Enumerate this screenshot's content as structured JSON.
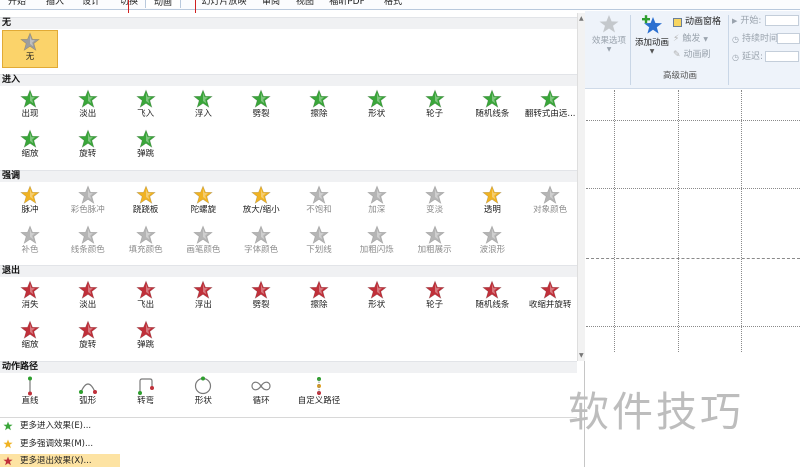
{
  "ribbon_tabs": [
    "开始",
    "插入",
    "设计",
    "切换",
    "动画",
    "幻灯片放映",
    "审阅",
    "视图",
    "福昕PDF",
    "格式"
  ],
  "active_tab": "动画",
  "ribbon": {
    "effect_options": "效果选项",
    "add_animation": "添加动画",
    "animation_pane": "动画窗格",
    "trigger": "触发",
    "animation_painter": "动画刷",
    "advanced_group": "高级动画",
    "start_label": "开始:",
    "duration_label": "持续时间:",
    "delay_label": "延迟:"
  },
  "sections": {
    "none": "无",
    "entrance": "进入",
    "emphasis": "强调",
    "exit": "退出",
    "motion": "动作路径"
  },
  "none_item": "无",
  "entrance_items": [
    "出现",
    "淡出",
    "飞入",
    "浮入",
    "劈裂",
    "擦除",
    "形状",
    "轮子",
    "随机线条",
    "翻转式由远...",
    "缩放",
    "旋转",
    "弹跳"
  ],
  "emphasis_items": [
    "脉冲",
    "彩色脉冲",
    "跷跷板",
    "陀螺旋",
    "放大/缩小",
    "不饱和",
    "加深",
    "变淡",
    "透明",
    "对象颜色",
    "补色",
    "线条颜色",
    "填充颜色",
    "画笔颜色",
    "字体颜色",
    "下划线",
    "加粗闪烁",
    "加粗展示",
    "波浪形"
  ],
  "exit_items": [
    "消失",
    "淡出",
    "飞出",
    "浮出",
    "劈裂",
    "擦除",
    "形状",
    "轮子",
    "随机线条",
    "收缩并旋转",
    "缩放",
    "旋转",
    "弹跳"
  ],
  "motion_items": [
    "直线",
    "弧形",
    "转弯",
    "形状",
    "循环",
    "自定义路径"
  ],
  "more_links": [
    "更多进入效果(E)...",
    "更多强调效果(M)...",
    "更多退出效果(X)..."
  ],
  "watermark": "软件技巧",
  "colors": {
    "entrance": "#3aa63a",
    "emphasis": "#f0b323",
    "exit": "#c0303a",
    "disabled": "#b5b5b5",
    "selected_bg": "#fbd36a"
  }
}
